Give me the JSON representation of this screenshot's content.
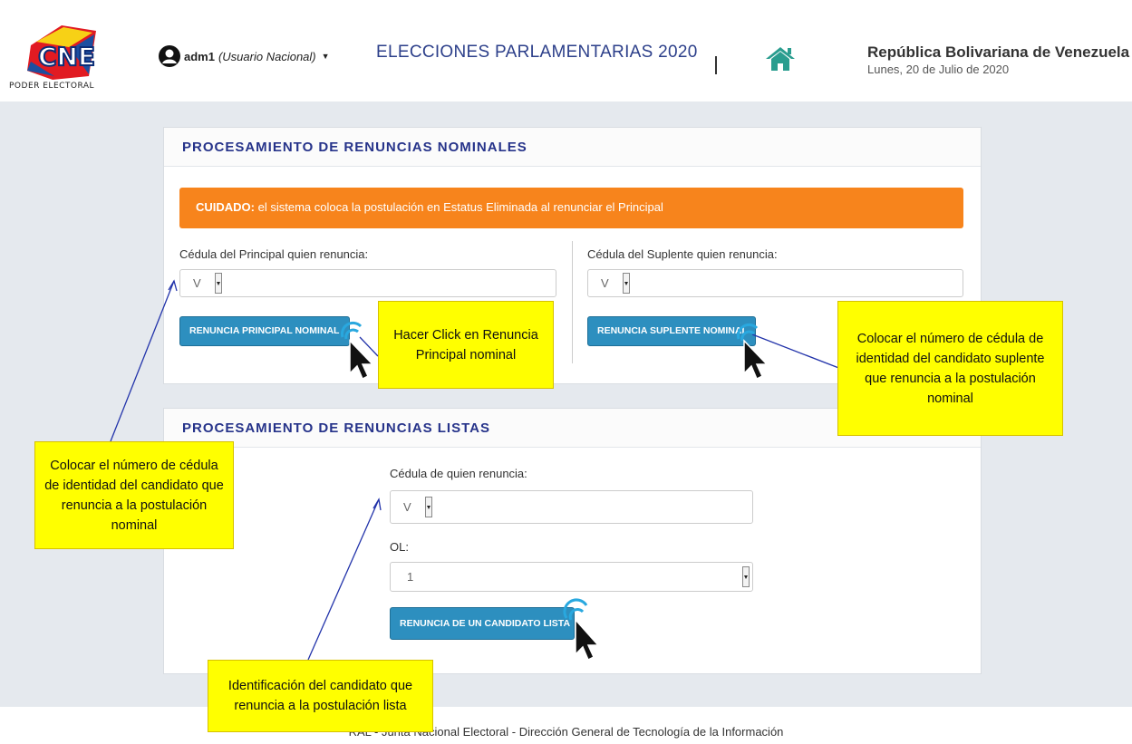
{
  "header": {
    "user": {
      "name": "adm1",
      "role": "(Usuario Nacional)"
    },
    "election": "ELECCIONES PARLAMENTARIAS 2020",
    "republic": "República Bolivariana de Venezuela",
    "date": "Lunes, 20 de Julio de 2020",
    "logo_text": "CNE",
    "logo_subtitle": "PODER ELECTORAL"
  },
  "panel_nominal": {
    "title": "PROCESAMIENTO DE RENUNCIAS NOMINALES",
    "alert_strong": "CUIDADO:",
    "alert_text": " el sistema coloca la postulación en Estatus Eliminada al renunciar el Principal",
    "principal_label": "Cédula del Principal quien renuncia:",
    "principal_prefix": "V",
    "suplente_label": "Cédula del Suplente quien renuncia:",
    "suplente_prefix": "V",
    "principal_button": "RENUNCIA PRINCIPAL NOMINAL",
    "suplente_button": "RENUNCIA SUPLENTE NOMINAL"
  },
  "panel_listas": {
    "title": "PROCESAMIENTO DE RENUNCIAS LISTAS",
    "cedula_label": "Cédula de quien renuncia:",
    "cedula_prefix": "V",
    "ol_label": "OL:",
    "ol_value": "1",
    "button": "RENUNCIA DE UN CANDIDATO LISTA"
  },
  "callouts": {
    "click_principal": "Hacer Click en Renuncia Principal nominal",
    "suplente": "Colocar el número de cédula de identidad del candidato suplente que renuncia a la postulación nominal",
    "principal": "Colocar el número de cédula de identidad del candidato que renuncia a la postulación nominal",
    "lista": "Identificación del candidato que renuncia a la postulación lista"
  },
  "footer": "RAL - Junta Nacional Electoral - Dirección General de Tecnología de la Información",
  "colors": {
    "accent": "#2d8fbf",
    "alert": "#f7841c",
    "title": "#26338a",
    "callout": "#ffff00"
  }
}
